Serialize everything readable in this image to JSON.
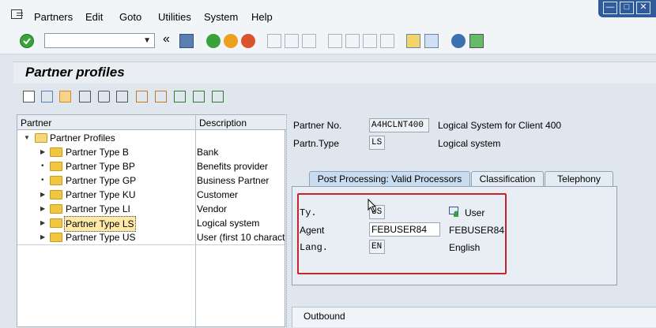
{
  "menu": [
    "Partners",
    "Edit",
    "Goto",
    "Utilities",
    "System",
    "Help"
  ],
  "toolbar": {
    "command_value": "",
    "back_glyph": "«"
  },
  "window_buttons": {
    "minimize": "—",
    "maximize": "□",
    "close": "✕"
  },
  "page_title": "Partner profiles",
  "tree": {
    "col_partner": "Partner",
    "col_description": "Description",
    "root_label": "Partner Profiles",
    "rows": [
      {
        "label": "Partner Type B",
        "desc": "Bank",
        "expander": "▶"
      },
      {
        "label": "Partner Type BP",
        "desc": "Benefits provider",
        "expander": "•"
      },
      {
        "label": "Partner Type GP",
        "desc": "Business Partner",
        "expander": "•"
      },
      {
        "label": "Partner Type KU",
        "desc": "Customer",
        "expander": "▶"
      },
      {
        "label": "Partner Type LI",
        "desc": "Vendor",
        "expander": "▶"
      },
      {
        "label": "Partner Type LS",
        "desc": "Logical system",
        "expander": "▶",
        "selected": true
      },
      {
        "label": "Partner Type US",
        "desc": "User (first 10 charact",
        "expander": "▶"
      }
    ]
  },
  "details": {
    "partner_no_label": "Partner No.",
    "partner_no_value": "A4HCLNT400",
    "partner_no_desc": "Logical System for Client 400",
    "partn_type_label": "Partn.Type",
    "partn_type_value": "LS",
    "partn_type_desc": "Logical system"
  },
  "tabs": [
    "Post Processing: Valid Processors",
    "Classification",
    "Telephony"
  ],
  "processors": {
    "ty_label": "Ty.",
    "ty_value": "US",
    "ty_desc": "User",
    "agent_label": "Agent",
    "agent_value": "FEBUSER84",
    "agent_desc": "FEBUSER84",
    "lang_label": "Lang.",
    "lang_value": "EN",
    "lang_desc": "English"
  },
  "outbound_label": "Outbound",
  "colors": {
    "accent": "#2f5b9c",
    "highlight_box": "#c8252b",
    "folder": "#f3c640"
  }
}
